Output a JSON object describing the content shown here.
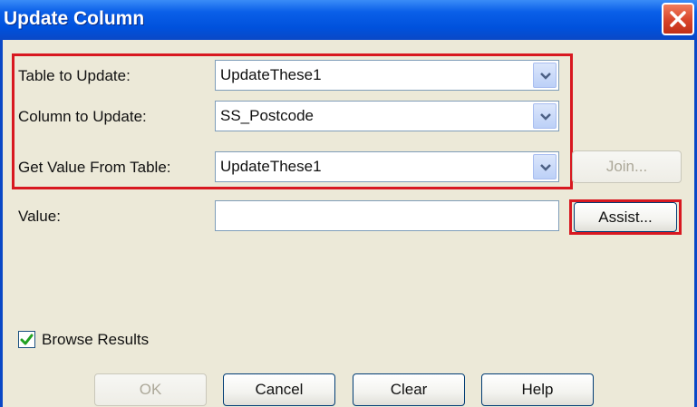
{
  "window": {
    "title": "Update Column"
  },
  "form": {
    "table_to_update": {
      "label": "Table to Update:",
      "value": "UpdateThese1"
    },
    "column_to_update": {
      "label": "Column to Update:",
      "value": "SS_Postcode"
    },
    "get_value_from_table": {
      "label": "Get Value From Table:",
      "value": "UpdateThese1"
    },
    "value": {
      "label": "Value:",
      "value": ""
    }
  },
  "buttons": {
    "join": "Join...",
    "assist": "Assist...",
    "ok": "OK",
    "cancel": "Cancel",
    "clear": "Clear",
    "help": "Help"
  },
  "options": {
    "browse_results": {
      "label": "Browse Results",
      "checked": true
    }
  },
  "colors": {
    "titlebar": "#0a5fe8",
    "highlight": "#d81820",
    "dialog_bg": "#ece9d8"
  },
  "icons": [
    "close-icon",
    "dropdown-arrow-icon",
    "checkmark-icon"
  ]
}
